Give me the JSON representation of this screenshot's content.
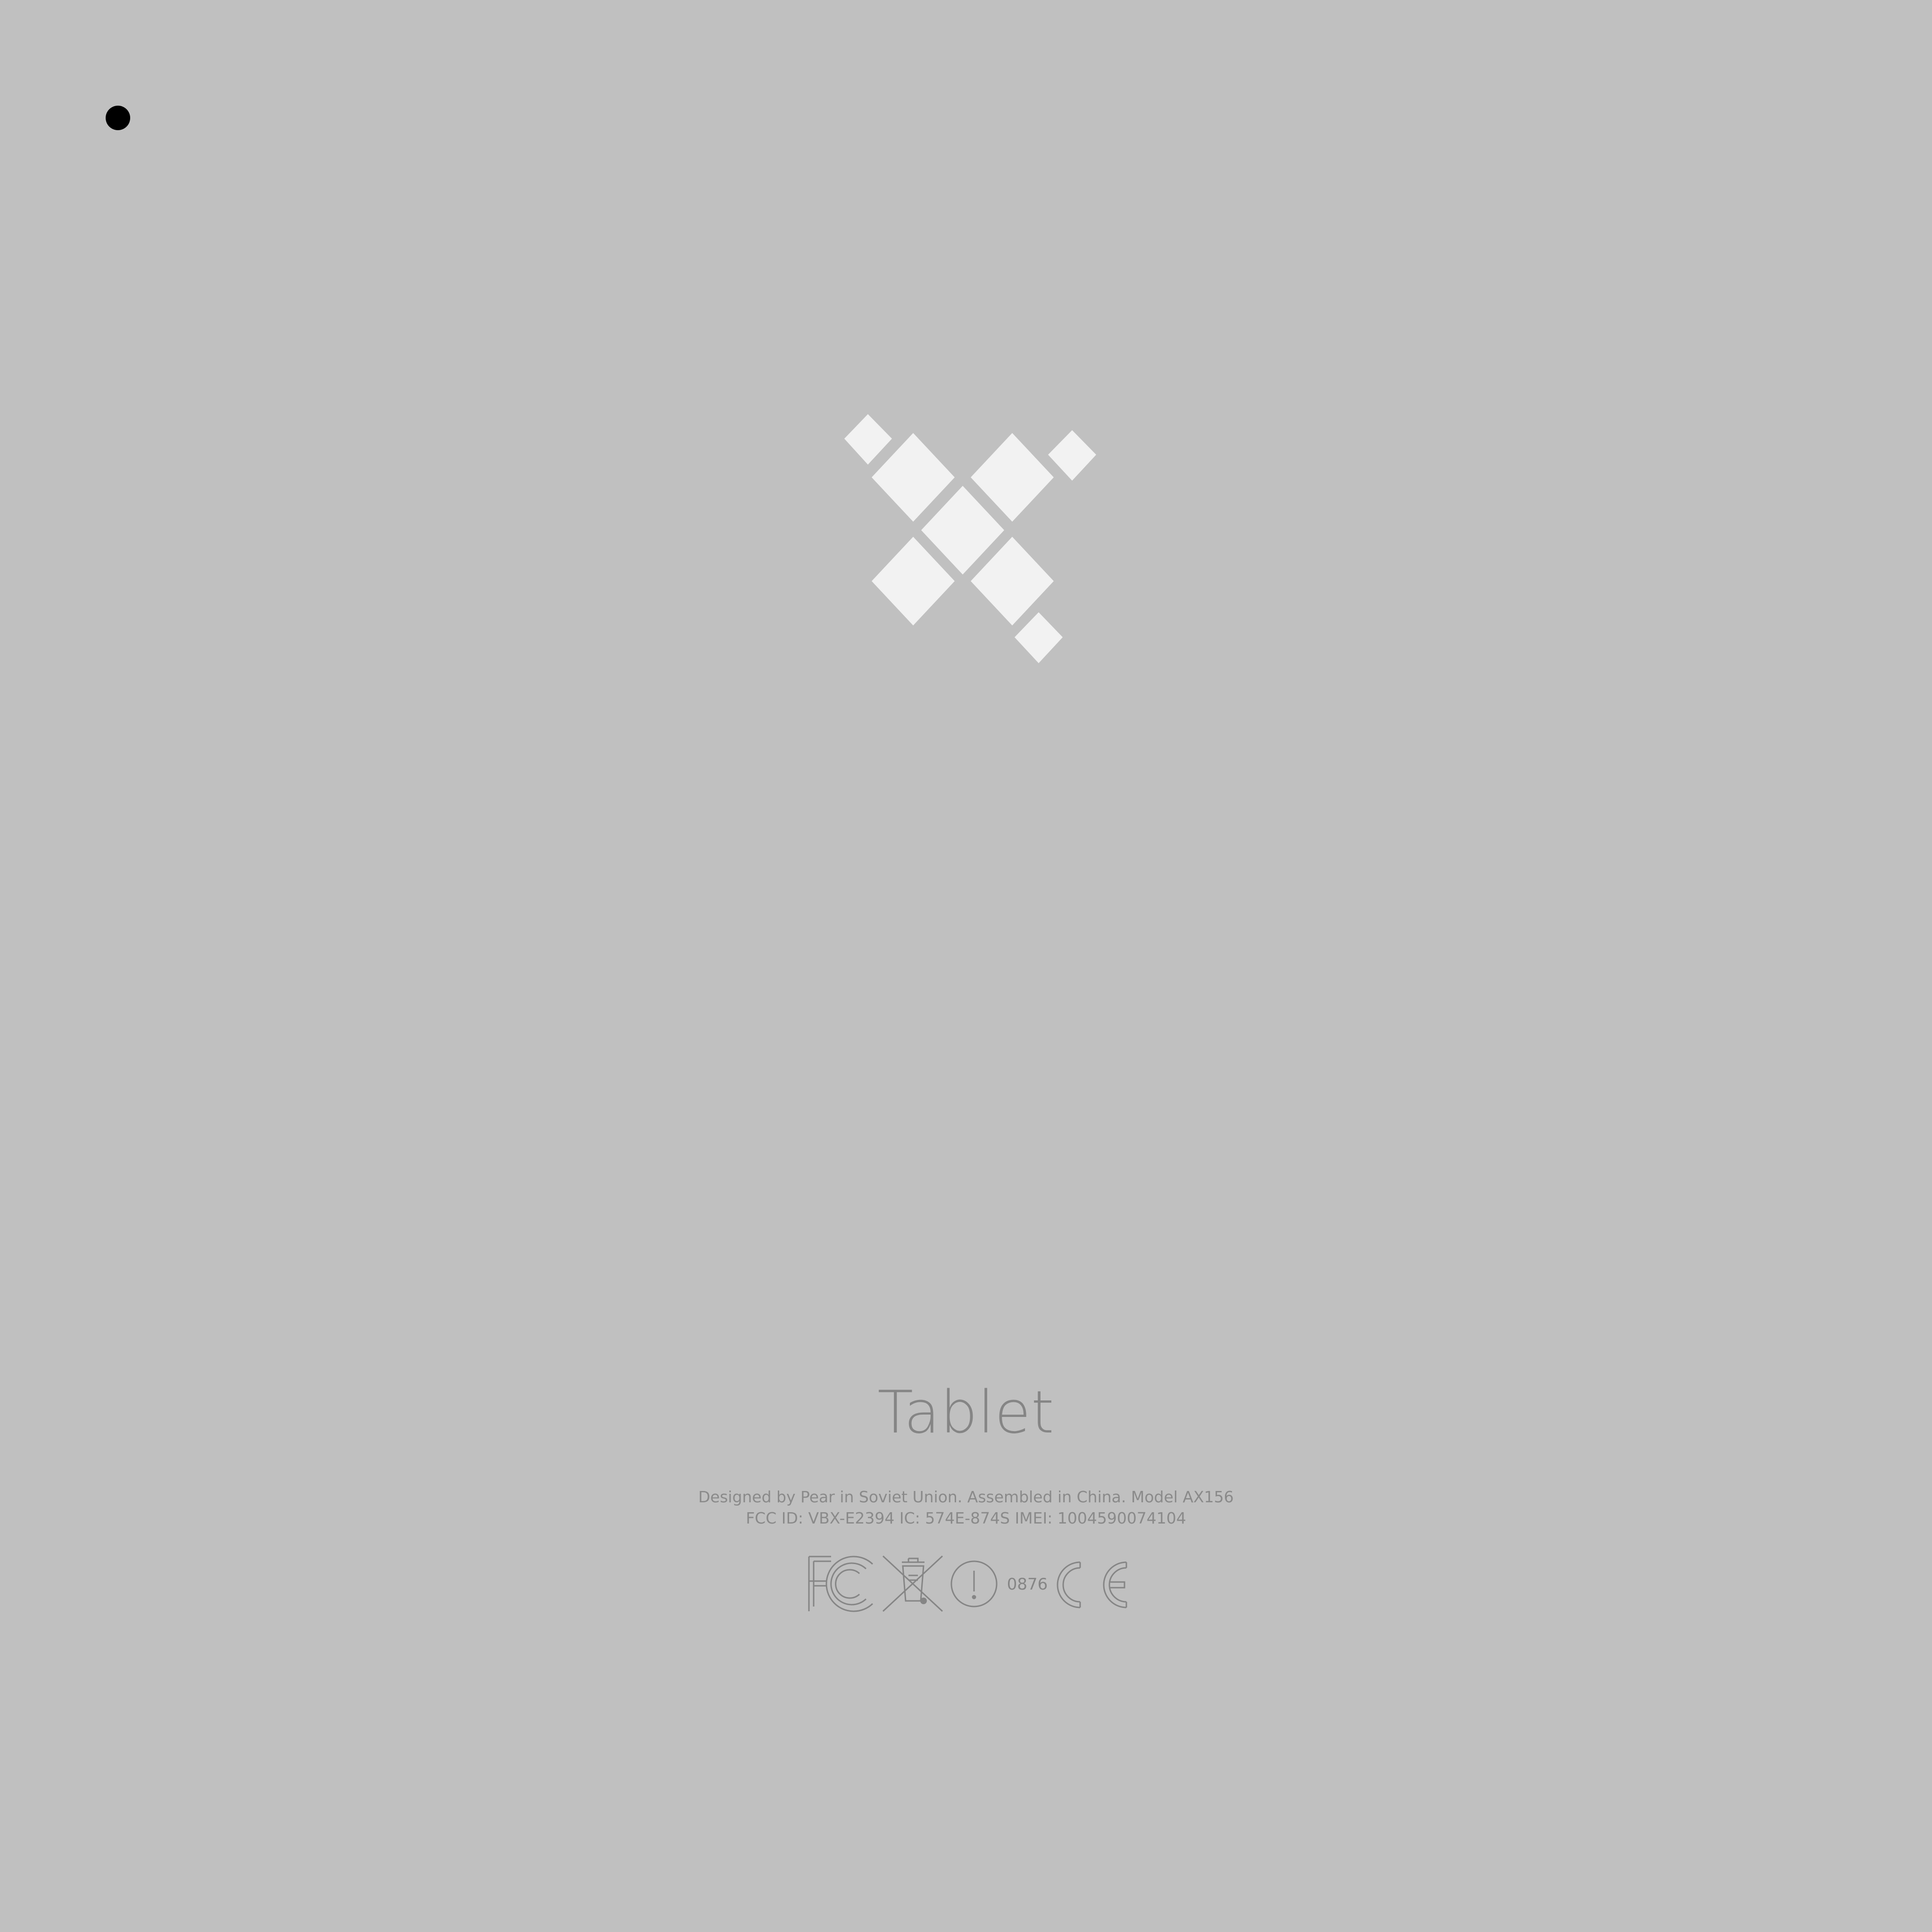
{
  "device": {
    "product_name": "Tablet",
    "legal_line_1": "Designed by Pear in Soviet Union. Assembled in China. Model AX156",
    "legal_line_2": "FCC ID: VBX-E2394 IC: 574E-874S IMEI: 1004590074104",
    "notified_body_number": "0876"
  },
  "icons": {
    "camera": "camera-dot-icon",
    "logo": "diamond-cross-logo-icon",
    "fcc": "fcc-mark-icon",
    "weee": "crossed-bin-icon",
    "alert": "exclamation-circle-icon",
    "ce": "ce-mark-icon"
  },
  "colors": {
    "background": "#c0c0c0",
    "logo": "#f2f2f2",
    "engraving": "#858585",
    "camera": "#000000"
  }
}
